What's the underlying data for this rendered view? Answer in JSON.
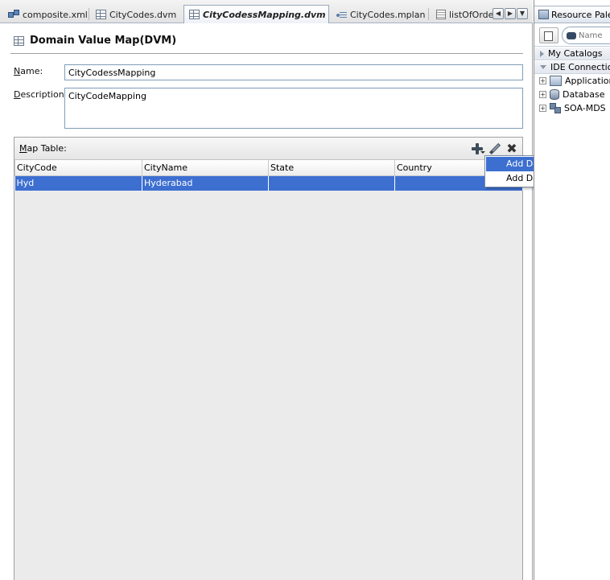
{
  "tabs": [
    {
      "label": "composite.xml",
      "icon": "composite-icon",
      "active": false
    },
    {
      "label": "CityCodes.dvm",
      "icon": "dvm-grid-icon",
      "active": false
    },
    {
      "label": "CityCodessMapping.dvm",
      "icon": "dvm-grid-icon",
      "active": true
    },
    {
      "label": "CityCodes.mplan",
      "icon": "mplan-icon",
      "active": false
    },
    {
      "label": "listOfOrder",
      "icon": "code-file-icon",
      "active": false
    }
  ],
  "tab_nav": {
    "prev": "◀",
    "next": "▶",
    "menu": "▼"
  },
  "editor": {
    "title": "Domain Value Map(DVM)",
    "name_label_underlined": "N",
    "name_label_rest": "ame:",
    "name_value": "CityCodessMapping",
    "description_label_underlined": "D",
    "description_label_rest": "escription:",
    "description_value": "CityCodeMapping"
  },
  "map_table": {
    "title_underlined": "M",
    "title_rest": "ap Table:",
    "columns": [
      "CityCode",
      "CityName",
      "State",
      "Country"
    ],
    "rows": [
      {
        "CityCode": "Hyd",
        "CityName": "Hyderabad",
        "State": "",
        "Country": "",
        "selected": true
      }
    ]
  },
  "context_menu": {
    "items": [
      {
        "label": "Add Domain Values",
        "highlighted": true
      },
      {
        "label": "Add Domain",
        "highlighted": false
      }
    ]
  },
  "resource_palette": {
    "title": "Resource Palette",
    "search_placeholder": "Name",
    "sections": {
      "my_catalogs": "My Catalogs",
      "ide_connections": "IDE Connections"
    },
    "tree_items": [
      {
        "label": "Application Server",
        "icon": "connection-icon"
      },
      {
        "label": "Database",
        "icon": "database-icon"
      },
      {
        "label": "SOA-MDS",
        "icon": "network-icon"
      }
    ]
  },
  "colors": {
    "selection": "#3d6fd1",
    "panel_bg": "#ebebeb",
    "input_border": "#7f9db9"
  }
}
